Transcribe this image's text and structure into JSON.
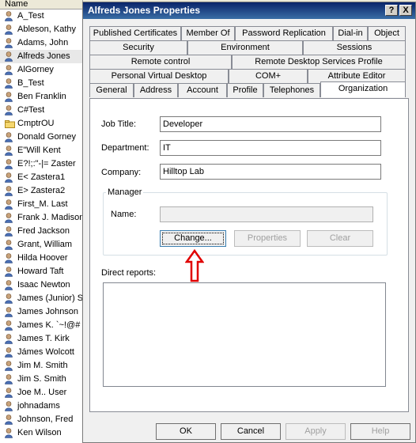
{
  "list_header": "Name",
  "list_items": [
    {
      "label": "A_Test",
      "type": "user"
    },
    {
      "label": "Ableson, Kathy",
      "type": "user"
    },
    {
      "label": "Adams, John",
      "type": "user"
    },
    {
      "label": "Alfreds Jones",
      "type": "user",
      "selected": true
    },
    {
      "label": "AlGorney",
      "type": "user"
    },
    {
      "label": "B_Test",
      "type": "user"
    },
    {
      "label": "Ben Franklin",
      "type": "user"
    },
    {
      "label": "C#Test",
      "type": "user"
    },
    {
      "label": "CmptrOU",
      "type": "ou"
    },
    {
      "label": "Donald Gorney",
      "type": "user"
    },
    {
      "label": "E\"Will Kent",
      "type": "user"
    },
    {
      "label": "E?!;:\"-|= Zaster",
      "type": "user"
    },
    {
      "label": "E< Zastera1",
      "type": "user"
    },
    {
      "label": "E> Zastera2",
      "type": "user"
    },
    {
      "label": "First_M. Last",
      "type": "user"
    },
    {
      "label": "Frank J. Madison",
      "type": "user"
    },
    {
      "label": "Fred Jackson",
      "type": "user"
    },
    {
      "label": "Grant, William",
      "type": "user"
    },
    {
      "label": "Hilda Hoover",
      "type": "user"
    },
    {
      "label": "Howard Taft",
      "type": "user"
    },
    {
      "label": "Isaac Newton",
      "type": "user"
    },
    {
      "label": "James (Junior) S",
      "type": "user"
    },
    {
      "label": "James Johnson",
      "type": "user"
    },
    {
      "label": "James K. `~!@#",
      "type": "user"
    },
    {
      "label": "James T. Kirk",
      "type": "user"
    },
    {
      "label": "Jámes Wolcott",
      "type": "user"
    },
    {
      "label": "Jim M. Smith",
      "type": "user"
    },
    {
      "label": "Jim S. Smith",
      "type": "user"
    },
    {
      "label": "Joe M.. User",
      "type": "user"
    },
    {
      "label": "johnadams",
      "type": "user"
    },
    {
      "label": "Johnson, Fred",
      "type": "user"
    },
    {
      "label": "Ken Wilson",
      "type": "user"
    }
  ],
  "dialog": {
    "title": "Alfreds Jones Properties",
    "help_button": "?",
    "close_button": "X",
    "tabs_row1": [
      "Published Certificates",
      "Member Of",
      "Password Replication",
      "Dial-in",
      "Object"
    ],
    "tabs_row2": [
      "Security",
      "Environment",
      "Sessions"
    ],
    "tabs_row3": [
      "Remote control",
      "Remote Desktop Services Profile"
    ],
    "tabs_row4": [
      "Personal Virtual Desktop",
      "COM+",
      "Attribute Editor"
    ],
    "tabs_row5": [
      "General",
      "Address",
      "Account",
      "Profile",
      "Telephones",
      "Organization"
    ],
    "active_tab": "Organization",
    "job_title_label": "Job Title:",
    "job_title_value": "Developer",
    "department_label": "Department:",
    "department_value": "IT",
    "company_label": "Company:",
    "company_value": "Hilltop Lab",
    "manager_group": "Manager",
    "manager_name_label": "Name:",
    "manager_name_value": "",
    "change_button": "Change...",
    "properties_button": "Properties",
    "clear_button": "Clear",
    "direct_reports_label": "Direct reports:",
    "ok_button": "OK",
    "cancel_button": "Cancel",
    "apply_button": "Apply",
    "help_bottom_button": "Help"
  },
  "colors": {
    "titlebar": "#0a246a",
    "annotation_arrow": "#e00000"
  }
}
